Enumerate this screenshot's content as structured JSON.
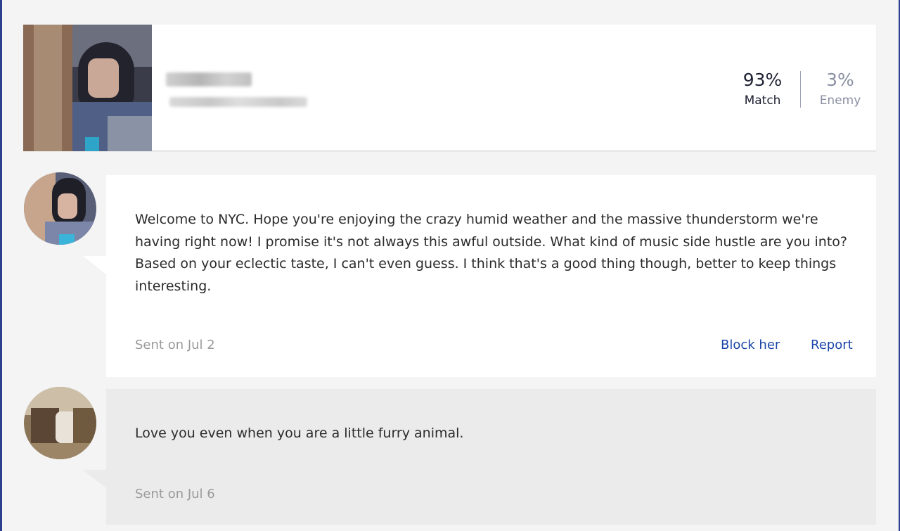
{
  "profile": {
    "name_blurred": "",
    "details_blurred": "",
    "match": {
      "value": "93%",
      "label": "Match"
    },
    "enemy": {
      "value": "3%",
      "label": "Enemy"
    }
  },
  "messages": [
    {
      "text": "Welcome to NYC. Hope you're enjoying the crazy humid weather and the massive thunderstorm we're having right now! I promise it's not always this awful outside. What kind of music side hustle are you into? Based on your eclectic taste, I can't even guess. I think that's a good thing though, better to keep things interesting.",
      "sent": "Sent on Jul 2",
      "actions": {
        "block": "Block her",
        "report": "Report"
      }
    },
    {
      "text": "Love you even when you are a little furry animal.",
      "sent": "Sent on Jul 6"
    }
  ],
  "colors": {
    "background": "#f4f4f4",
    "link": "#1b46a8",
    "own_bubble": "#ebebeb"
  }
}
